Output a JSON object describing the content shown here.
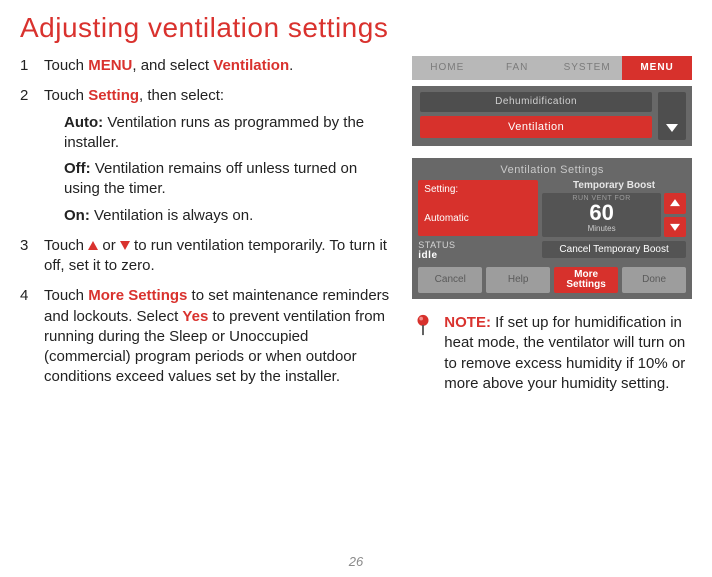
{
  "title": "Adjusting ventilation settings",
  "steps": {
    "s1a": "Touch ",
    "s1_menu": "MENU",
    "s1b": ", and select ",
    "s1_vent": "Ventilation",
    "s1c": ".",
    "s2a": "Touch ",
    "s2_setting": "Setting",
    "s2b": ", then select:",
    "s2_auto_label": "Auto:",
    "s2_auto_text": " Ventilation runs as programmed by the installer.",
    "s2_off_label": "Off:",
    "s2_off_text": " Ventilation remains off unless turned on using the timer.",
    "s2_on_label": "On:",
    "s2_on_text": " Ventilation is always on.",
    "s3a": "Touch ",
    "s3b": " or ",
    "s3c": " to run ventilation temporarily. To turn it off, set it to zero.",
    "s4a": "Touch ",
    "s4_more": "More Settings",
    "s4b": " to set maintenance reminders and lockouts. Select ",
    "s4_yes": "Yes",
    "s4c": " to prevent ventilation from running during the Sleep or Unoccupied (commercial) program periods or when outdoor conditions exceed values set by the installer."
  },
  "tabs": [
    "HOME",
    "FAN",
    "SYSTEM",
    "MENU"
  ],
  "menu": {
    "dehumid": "Dehumidification",
    "ventilation": "Ventilation"
  },
  "panel": {
    "title": "Ventilation Settings",
    "setting_label": "Setting:",
    "setting_value": "Automatic",
    "boost_title": "Temporary Boost",
    "boost_caption": "RUN VENT FOR",
    "boost_value": "60",
    "boost_unit": "Minutes",
    "status_label": "STATUS",
    "status_value": "idle",
    "cancel_boost": "Cancel Temporary Boost",
    "buttons": {
      "cancel": "Cancel",
      "help": "Help",
      "more": "More Settings",
      "done": "Done"
    }
  },
  "note": {
    "label": "NOTE:",
    "text": " If set up for humidification in heat mode, the ventilator will turn on to remove excess humidity if 10% or more above your humidity setting."
  },
  "page": "26"
}
